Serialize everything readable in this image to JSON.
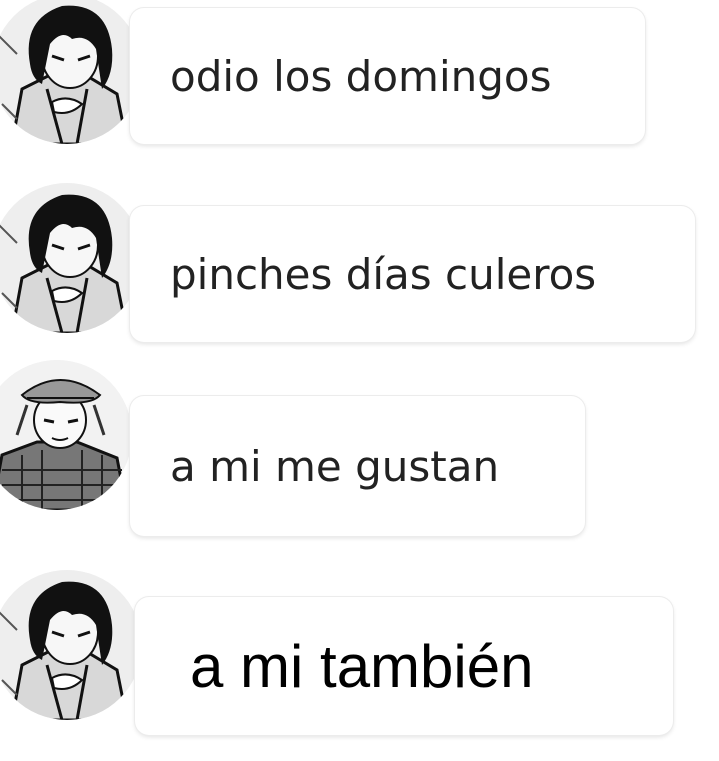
{
  "messages": [
    {
      "avatar": "dark-haired-manga-character",
      "text": "odio los domingos"
    },
    {
      "avatar": "dark-haired-manga-character",
      "text": "pinches días culeros"
    },
    {
      "avatar": "bandana-manga-character",
      "text": "a mi me gustan"
    },
    {
      "avatar": "dark-haired-manga-character",
      "text": "a mi también"
    }
  ]
}
